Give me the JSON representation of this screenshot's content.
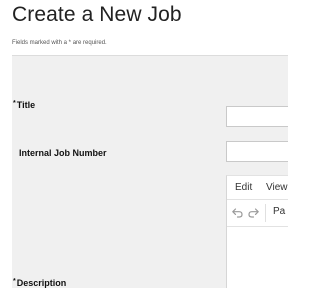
{
  "page": {
    "title": "Create a New Job",
    "required_note": "Fields marked with a * are required."
  },
  "form": {
    "title_field": {
      "required_marker": "*",
      "label": "Title",
      "value": ""
    },
    "job_number_field": {
      "label": "Internal Job Number",
      "value": ""
    },
    "description_field": {
      "required_marker": "*",
      "label": "Description"
    }
  },
  "editor": {
    "menu": {
      "edit_label": "Edit",
      "view_label": "View"
    },
    "toolbar": {
      "undo_icon": "undo-icon",
      "redo_icon": "redo-icon",
      "format_label": "Pa"
    }
  },
  "colors": {
    "panel_background": "#f0f0f0",
    "input_border": "#c9c9c9",
    "icon_gray": "#9a9a9a"
  }
}
